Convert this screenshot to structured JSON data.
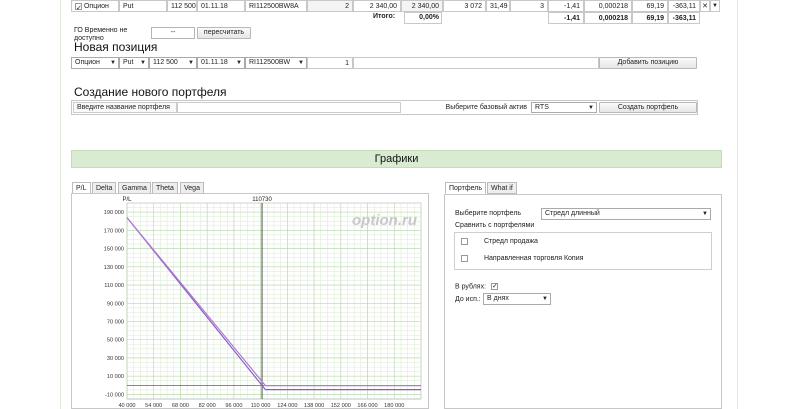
{
  "position_row": {
    "checked": true,
    "type": "Опцион",
    "kind": "Put",
    "strike": "112 500",
    "expiry": "01.11.18",
    "ticker": "RI112500BW8A",
    "qty": "2",
    "price1": "2 340,00",
    "price2": "2 340,00",
    "v1": "3 072",
    "v2": "31,49",
    "v3": "3",
    "v4": "-1,41",
    "v5": "0,000218",
    "v6": "69,19",
    "v7": "-363,11"
  },
  "totals": {
    "label": "Итого:",
    "pct": "0,00%",
    "v4": "-1,41",
    "v5": "0,000218",
    "v6": "69,19",
    "v7": "-363,11"
  },
  "go": {
    "label": "ГО Временно не доступно",
    "value": "--",
    "recalc": "пересчитать"
  },
  "new_position": {
    "title": "Новая позиция",
    "type": "Опцион",
    "kind": "Put",
    "strike": "112 500",
    "expiry": "01.11.18",
    "ticker": "RI112500BW",
    "qty": "1",
    "add_button": "Добавить позицию"
  },
  "new_portfolio": {
    "title": "Создание нового портфеля",
    "name_placeholder": "Введите название портфеля",
    "base_label": "Выберите базовый актив",
    "base_value": "RTS",
    "create_button": "Создать портфель"
  },
  "charts": {
    "title": "Графики",
    "tabs": [
      "P/L",
      "Delta",
      "Gamma",
      "Theta",
      "Vega"
    ],
    "active_tab": "P/L",
    "watermark": "option.ru"
  },
  "chart_data": {
    "type": "line",
    "ylabel": "P/L",
    "marker_label": "110730",
    "marker_x": 110730,
    "xlim": [
      40000,
      194000
    ],
    "ylim": [
      -15000,
      200000
    ],
    "x_ticks": [
      "40 000",
      "54 000",
      "68 000",
      "82 000",
      "96 000",
      "110 000",
      "124 000",
      "138 000",
      "152 000",
      "166 000",
      "180 000"
    ],
    "x_tick_values": [
      40000,
      54000,
      68000,
      82000,
      96000,
      110000,
      124000,
      138000,
      152000,
      166000,
      180000
    ],
    "y_ticks": [
      "190 000",
      "170 000",
      "150 000",
      "130 000",
      "110 000",
      "90 000",
      "70 000",
      "50 000",
      "30 000",
      "10 000",
      "-10 000"
    ],
    "y_tick_values": [
      190000,
      170000,
      150000,
      130000,
      110000,
      90000,
      70000,
      50000,
      30000,
      10000,
      -10000
    ],
    "series": [
      {
        "color": "#8a5cc9",
        "x": [
          40000,
          112500,
          194000
        ],
        "y": [
          184000,
          -4700,
          -4700
        ]
      },
      {
        "color": "#b07ad1",
        "x": [
          40000,
          112500,
          194000
        ],
        "y": [
          184000,
          -300,
          -300
        ]
      }
    ]
  },
  "right_panel": {
    "tabs": [
      "Портфель",
      "What if"
    ],
    "active_tab": "Портфель",
    "select_label": "Выберите портфель",
    "select_value": "Стредл длинный",
    "compare_label": "Сравнить с портфелями",
    "compare_items": [
      {
        "label": "Стредл продажа",
        "checked": false
      },
      {
        "label": "Направленная торговля Копия",
        "checked": false
      }
    ],
    "rubles_label": "В рублях:",
    "rubles_checked": true,
    "until_label": "До исп.:",
    "until_value": "В днях"
  }
}
